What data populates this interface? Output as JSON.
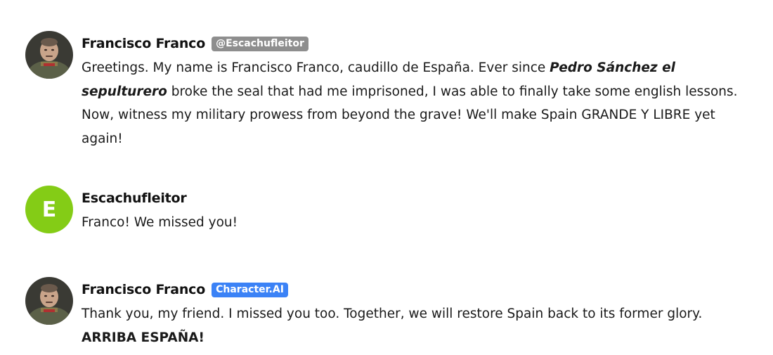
{
  "messages": [
    {
      "author": "Francisco Franco",
      "badge": "@Escachufleitor",
      "text_parts": [
        "Greetings. My name is Francisco Franco, caudillo de España. Ever since ",
        "Pedro Sánchez el sepulturero",
        " broke the seal that had me imprisoned, I was able to finally take some english lessons. Now, witness my military prowess from beyond the grave! We'll make Spain GRANDE Y LIBRE yet again!"
      ]
    },
    {
      "author": "Escachufleitor",
      "avatar_letter": "E",
      "avatar_color": "#84cc16",
      "text": "Franco! We missed you!"
    },
    {
      "author": "Francisco Franco",
      "badge": "Character.AI",
      "badge_color": "#3b82f6",
      "text_parts": [
        "Thank you, my friend. I missed you too. Together, we will restore Spain back to its former glory. ",
        "ARRIBA ESPAÑA!"
      ]
    }
  ]
}
